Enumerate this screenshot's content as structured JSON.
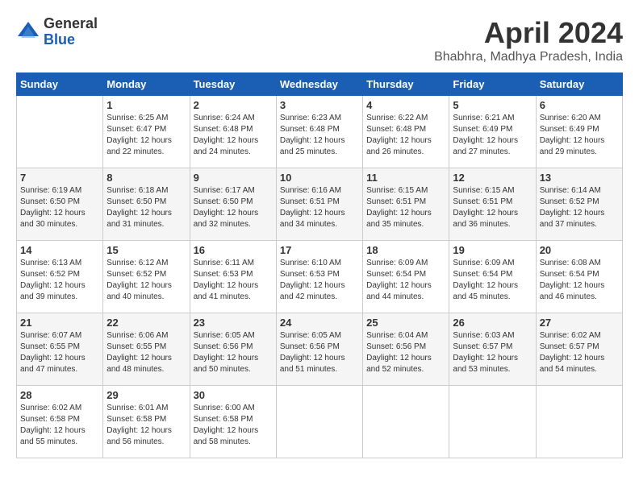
{
  "logo": {
    "general": "General",
    "blue": "Blue"
  },
  "title": "April 2024",
  "location": "Bhabhra, Madhya Pradesh, India",
  "weekdays": [
    "Sunday",
    "Monday",
    "Tuesday",
    "Wednesday",
    "Thursday",
    "Friday",
    "Saturday"
  ],
  "weeks": [
    [
      {
        "day": "",
        "sunrise": "",
        "sunset": "",
        "daylight": ""
      },
      {
        "day": "1",
        "sunrise": "Sunrise: 6:25 AM",
        "sunset": "Sunset: 6:47 PM",
        "daylight": "Daylight: 12 hours and 22 minutes."
      },
      {
        "day": "2",
        "sunrise": "Sunrise: 6:24 AM",
        "sunset": "Sunset: 6:48 PM",
        "daylight": "Daylight: 12 hours and 24 minutes."
      },
      {
        "day": "3",
        "sunrise": "Sunrise: 6:23 AM",
        "sunset": "Sunset: 6:48 PM",
        "daylight": "Daylight: 12 hours and 25 minutes."
      },
      {
        "day": "4",
        "sunrise": "Sunrise: 6:22 AM",
        "sunset": "Sunset: 6:48 PM",
        "daylight": "Daylight: 12 hours and 26 minutes."
      },
      {
        "day": "5",
        "sunrise": "Sunrise: 6:21 AM",
        "sunset": "Sunset: 6:49 PM",
        "daylight": "Daylight: 12 hours and 27 minutes."
      },
      {
        "day": "6",
        "sunrise": "Sunrise: 6:20 AM",
        "sunset": "Sunset: 6:49 PM",
        "daylight": "Daylight: 12 hours and 29 minutes."
      }
    ],
    [
      {
        "day": "7",
        "sunrise": "Sunrise: 6:19 AM",
        "sunset": "Sunset: 6:50 PM",
        "daylight": "Daylight: 12 hours and 30 minutes."
      },
      {
        "day": "8",
        "sunrise": "Sunrise: 6:18 AM",
        "sunset": "Sunset: 6:50 PM",
        "daylight": "Daylight: 12 hours and 31 minutes."
      },
      {
        "day": "9",
        "sunrise": "Sunrise: 6:17 AM",
        "sunset": "Sunset: 6:50 PM",
        "daylight": "Daylight: 12 hours and 32 minutes."
      },
      {
        "day": "10",
        "sunrise": "Sunrise: 6:16 AM",
        "sunset": "Sunset: 6:51 PM",
        "daylight": "Daylight: 12 hours and 34 minutes."
      },
      {
        "day": "11",
        "sunrise": "Sunrise: 6:15 AM",
        "sunset": "Sunset: 6:51 PM",
        "daylight": "Daylight: 12 hours and 35 minutes."
      },
      {
        "day": "12",
        "sunrise": "Sunrise: 6:15 AM",
        "sunset": "Sunset: 6:51 PM",
        "daylight": "Daylight: 12 hours and 36 minutes."
      },
      {
        "day": "13",
        "sunrise": "Sunrise: 6:14 AM",
        "sunset": "Sunset: 6:52 PM",
        "daylight": "Daylight: 12 hours and 37 minutes."
      }
    ],
    [
      {
        "day": "14",
        "sunrise": "Sunrise: 6:13 AM",
        "sunset": "Sunset: 6:52 PM",
        "daylight": "Daylight: 12 hours and 39 minutes."
      },
      {
        "day": "15",
        "sunrise": "Sunrise: 6:12 AM",
        "sunset": "Sunset: 6:52 PM",
        "daylight": "Daylight: 12 hours and 40 minutes."
      },
      {
        "day": "16",
        "sunrise": "Sunrise: 6:11 AM",
        "sunset": "Sunset: 6:53 PM",
        "daylight": "Daylight: 12 hours and 41 minutes."
      },
      {
        "day": "17",
        "sunrise": "Sunrise: 6:10 AM",
        "sunset": "Sunset: 6:53 PM",
        "daylight": "Daylight: 12 hours and 42 minutes."
      },
      {
        "day": "18",
        "sunrise": "Sunrise: 6:09 AM",
        "sunset": "Sunset: 6:54 PM",
        "daylight": "Daylight: 12 hours and 44 minutes."
      },
      {
        "day": "19",
        "sunrise": "Sunrise: 6:09 AM",
        "sunset": "Sunset: 6:54 PM",
        "daylight": "Daylight: 12 hours and 45 minutes."
      },
      {
        "day": "20",
        "sunrise": "Sunrise: 6:08 AM",
        "sunset": "Sunset: 6:54 PM",
        "daylight": "Daylight: 12 hours and 46 minutes."
      }
    ],
    [
      {
        "day": "21",
        "sunrise": "Sunrise: 6:07 AM",
        "sunset": "Sunset: 6:55 PM",
        "daylight": "Daylight: 12 hours and 47 minutes."
      },
      {
        "day": "22",
        "sunrise": "Sunrise: 6:06 AM",
        "sunset": "Sunset: 6:55 PM",
        "daylight": "Daylight: 12 hours and 48 minutes."
      },
      {
        "day": "23",
        "sunrise": "Sunrise: 6:05 AM",
        "sunset": "Sunset: 6:56 PM",
        "daylight": "Daylight: 12 hours and 50 minutes."
      },
      {
        "day": "24",
        "sunrise": "Sunrise: 6:05 AM",
        "sunset": "Sunset: 6:56 PM",
        "daylight": "Daylight: 12 hours and 51 minutes."
      },
      {
        "day": "25",
        "sunrise": "Sunrise: 6:04 AM",
        "sunset": "Sunset: 6:56 PM",
        "daylight": "Daylight: 12 hours and 52 minutes."
      },
      {
        "day": "26",
        "sunrise": "Sunrise: 6:03 AM",
        "sunset": "Sunset: 6:57 PM",
        "daylight": "Daylight: 12 hours and 53 minutes."
      },
      {
        "day": "27",
        "sunrise": "Sunrise: 6:02 AM",
        "sunset": "Sunset: 6:57 PM",
        "daylight": "Daylight: 12 hours and 54 minutes."
      }
    ],
    [
      {
        "day": "28",
        "sunrise": "Sunrise: 6:02 AM",
        "sunset": "Sunset: 6:58 PM",
        "daylight": "Daylight: 12 hours and 55 minutes."
      },
      {
        "day": "29",
        "sunrise": "Sunrise: 6:01 AM",
        "sunset": "Sunset: 6:58 PM",
        "daylight": "Daylight: 12 hours and 56 minutes."
      },
      {
        "day": "30",
        "sunrise": "Sunrise: 6:00 AM",
        "sunset": "Sunset: 6:58 PM",
        "daylight": "Daylight: 12 hours and 58 minutes."
      },
      {
        "day": "",
        "sunrise": "",
        "sunset": "",
        "daylight": ""
      },
      {
        "day": "",
        "sunrise": "",
        "sunset": "",
        "daylight": ""
      },
      {
        "day": "",
        "sunrise": "",
        "sunset": "",
        "daylight": ""
      },
      {
        "day": "",
        "sunrise": "",
        "sunset": "",
        "daylight": ""
      }
    ]
  ]
}
